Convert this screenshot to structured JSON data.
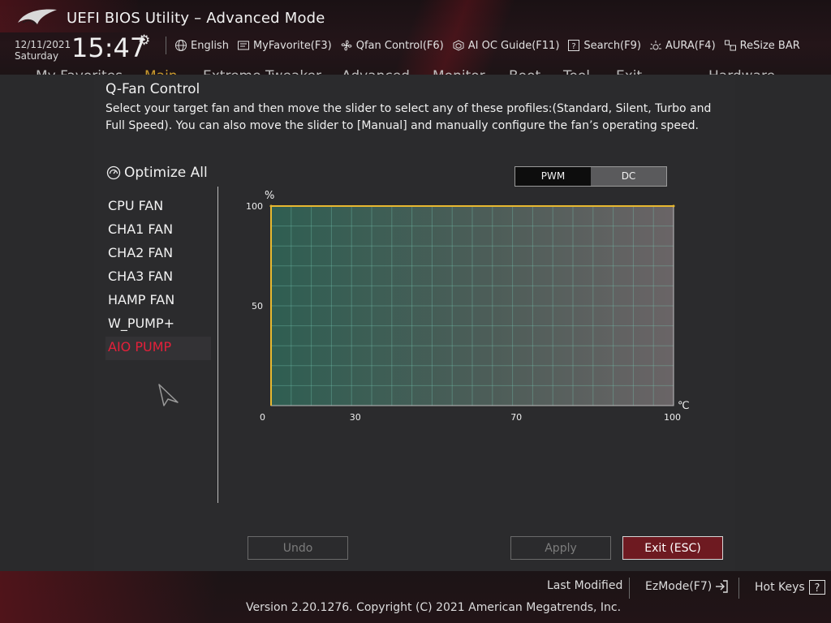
{
  "app": {
    "title": "UEFI BIOS Utility – Advanced Mode"
  },
  "clock": {
    "date": "12/11/2021",
    "day": "Saturday",
    "time": "15:47"
  },
  "toolbar": [
    {
      "name": "language-button",
      "icon": "globe-icon",
      "label": "English"
    },
    {
      "name": "myfavorite-button",
      "icon": "favorite-icon",
      "label": "MyFavorite(F3)"
    },
    {
      "name": "qfan-control-button",
      "icon": "fan-icon",
      "label": "Qfan Control(F6)"
    },
    {
      "name": "ai-oc-guide-button",
      "icon": "chip-icon",
      "label": "AI OC Guide(F11)"
    },
    {
      "name": "search-button",
      "icon": "question-icon",
      "label": "Search(F9)"
    },
    {
      "name": "aura-button",
      "icon": "aura-icon",
      "label": "AURA(F4)"
    },
    {
      "name": "resize-bar-button",
      "icon": "resize-bar-icon",
      "label": "ReSize BAR"
    }
  ],
  "menu": [
    "My Favorites",
    "Main",
    "Extreme Tweaker",
    "Advanced",
    "Monitor",
    "Boot",
    "Tool",
    "Exit",
    "Hardware Monitor"
  ],
  "dialog": {
    "title": "Q-Fan Control",
    "description": "Select your target fan and then move the slider to select any of these profiles:(Standard, Silent, Turbo and Full Speed). You can also move the slider to [Manual] and manually configure the fan’s operating speed.",
    "optimize_label": "Optimize All",
    "fans": [
      "CPU FAN",
      "CHA1 FAN",
      "CHA2 FAN",
      "CHA3 FAN",
      "HAMP FAN",
      "W_PUMP+",
      "AIO PUMP"
    ],
    "selected_fan": "AIO PUMP",
    "mode_options": [
      "PWM",
      "DC"
    ],
    "active_mode": "PWM",
    "buttons": {
      "undo": "Undo",
      "apply": "Apply",
      "exit": "Exit (ESC)"
    }
  },
  "chart_data": {
    "type": "line",
    "x": [
      0,
      100
    ],
    "y": [
      100,
      100
    ],
    "ylabel": "%",
    "xlabel": "℃",
    "xlim": [
      0,
      100
    ],
    "ylim": [
      0,
      100
    ],
    "xticks": [
      0,
      30,
      70,
      100
    ],
    "yticks": [
      50,
      100
    ],
    "grid": true,
    "line_color": "#e8b830"
  },
  "footer": {
    "last_modified": "Last Modified",
    "ezmode": "EzMode(F7)",
    "hotkeys": "Hot Keys",
    "version": "Version 2.20.1276. Copyright (C) 2021 American Megatrends, Inc."
  },
  "colors": {
    "accent": "#e4203a",
    "gold": "#c99a2e",
    "exit_button": "#6e1a21"
  }
}
